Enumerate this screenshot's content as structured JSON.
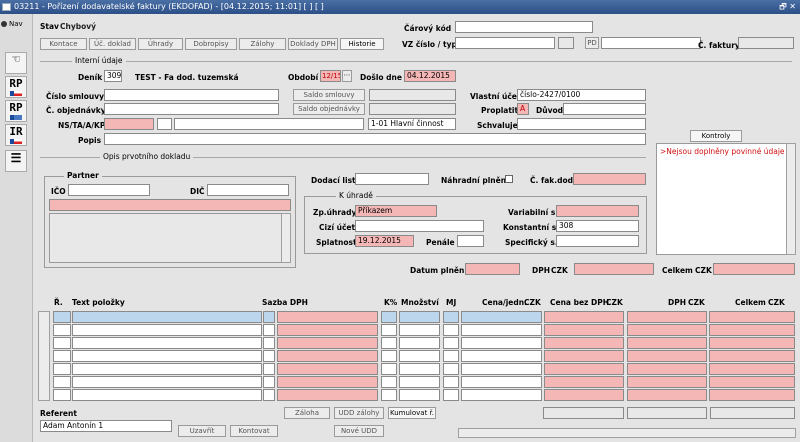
{
  "window": {
    "title": "03211 - Pořízení dodavatelské faktury (EKDOFAD) - [04.12.2015; 11:01] [ ] [ ]",
    "controls": "🗗 ✕"
  },
  "left": {
    "nav_label": "Nav",
    "tools": [
      "",
      "RP",
      "RP",
      "IR",
      ""
    ]
  },
  "header": {
    "stav_label": "Stav",
    "stav_value": "Chybový",
    "carovy_kod_label": "Čárový kód",
    "vz_label": "VZ číslo / typ",
    "pd_label": "PD",
    "cf_label": "Č. faktury"
  },
  "tabs": [
    "Kontace",
    "Úč. doklad",
    "Úhrady",
    "Dobropisy",
    "Zálohy",
    "Doklady DPH",
    "Historie"
  ],
  "interni": {
    "section": "Interní údaje",
    "denik_label": "Deník",
    "denik_code": "309",
    "denik_name": "TEST - Fa dod. tuzemská",
    "obdobi_label": "Období",
    "obdobi_value": "12/15",
    "doslo_label": "Došlo dne",
    "doslo_value": "04.12.2015",
    "smlouva_label": "Číslo smlouvy",
    "saldo_smlouvy": "Saldo smlouvy",
    "objednavka_label": "Č. objednávky",
    "saldo_objednavky": "Saldo objednávky",
    "vlastni_ucet_label": "Vlastní účet",
    "vlastni_ucet_value": "číslo-2427/0100",
    "proplatit_label": "Proplatit",
    "proplatit_value": "A",
    "duvod_label": "Důvod",
    "ns_label": "NS/TA/A/KP",
    "cinnost_value": "1-01 Hlavní činnost",
    "schvaluje_label": "Schvaluje",
    "popis_label": "Popis"
  },
  "kontroly": {
    "button": "Kontroly",
    "message": ">Nejsou doplněny povinné údaje"
  },
  "opis": {
    "section": "Opis prvotního dokladu",
    "partner_label": "Partner",
    "ico_label": "IČO",
    "dic_label": "DIČ",
    "dodaci_label": "Dodací list",
    "nahradni_label": "Náhradní plnění",
    "cfak_label": "Č. fak.dod"
  },
  "uhrada": {
    "section": "K úhradě",
    "zp_label": "Zp.úhrady",
    "zp_value": "Příkazem",
    "cizi_label": "Cizí účet",
    "splatnost_label": "Splatnost",
    "splatnost_value": "19.12.2015",
    "penale_label": "Penále",
    "vs_label": "Variabilní s.",
    "ks_label": "Konstantní s.",
    "ks_value": "308",
    "ss_label": "Specifický s."
  },
  "totals": {
    "datum_label": "Datum plnění",
    "dph_label": "DPH",
    "celkem_label": "Celkem",
    "czk": "CZK"
  },
  "grid": {
    "columns": [
      "Ř.",
      "Text položky",
      "Sazba DPH",
      "K%",
      "Množství",
      "MJ",
      "Cena/jedn.",
      "Cena bez DPH",
      "DPH",
      "Celkem"
    ],
    "currency": "CZK"
  },
  "bottom": {
    "referent_label": "Referent",
    "referent_value": "Adam Antonín 1",
    "uzavrit": "Uzavřít",
    "kontovat": "Kontovat",
    "zaloha": "Záloha",
    "udd_zalohy": "UDD zálohy",
    "kumulovat": "Kumulovat ř.",
    "nove_udd": "Nové UDD"
  }
}
